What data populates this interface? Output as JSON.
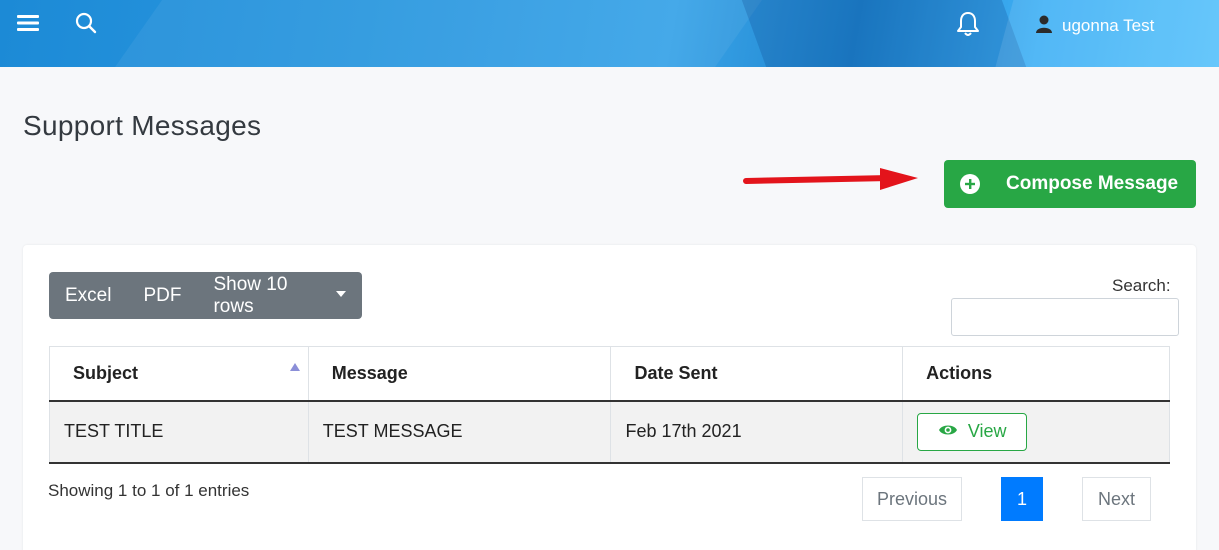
{
  "topbar": {
    "menu_icon": "hamburger-menu-icon",
    "search_icon": "search-icon",
    "notification_icon": "bell-icon",
    "user_icon": "user-icon",
    "user_name": "ugonna Test"
  },
  "page": {
    "title": "Support Messages"
  },
  "compose": {
    "label": "Compose Message",
    "icon": "plus-circle-icon",
    "color": "#28a745"
  },
  "toolbar": {
    "excel_label": "Excel",
    "pdf_label": "PDF",
    "rows_label": "Show 10 rows"
  },
  "search": {
    "label": "Search:",
    "value": ""
  },
  "table": {
    "columns": [
      "Subject",
      "Message",
      "Date Sent",
      "Actions"
    ],
    "rows": [
      {
        "subject": "TEST TITLE",
        "message": "TEST MESSAGE",
        "date_sent": "Feb 17th 2021",
        "action_label": "View"
      }
    ]
  },
  "footer": {
    "info": "Showing 1 to 1 of 1 entries",
    "previous_label": "Previous",
    "current_page": "1",
    "next_label": "Next"
  },
  "colors": {
    "accent_blue": "#007bff",
    "success_green": "#28a745",
    "arrow_red": "#e3141b"
  }
}
